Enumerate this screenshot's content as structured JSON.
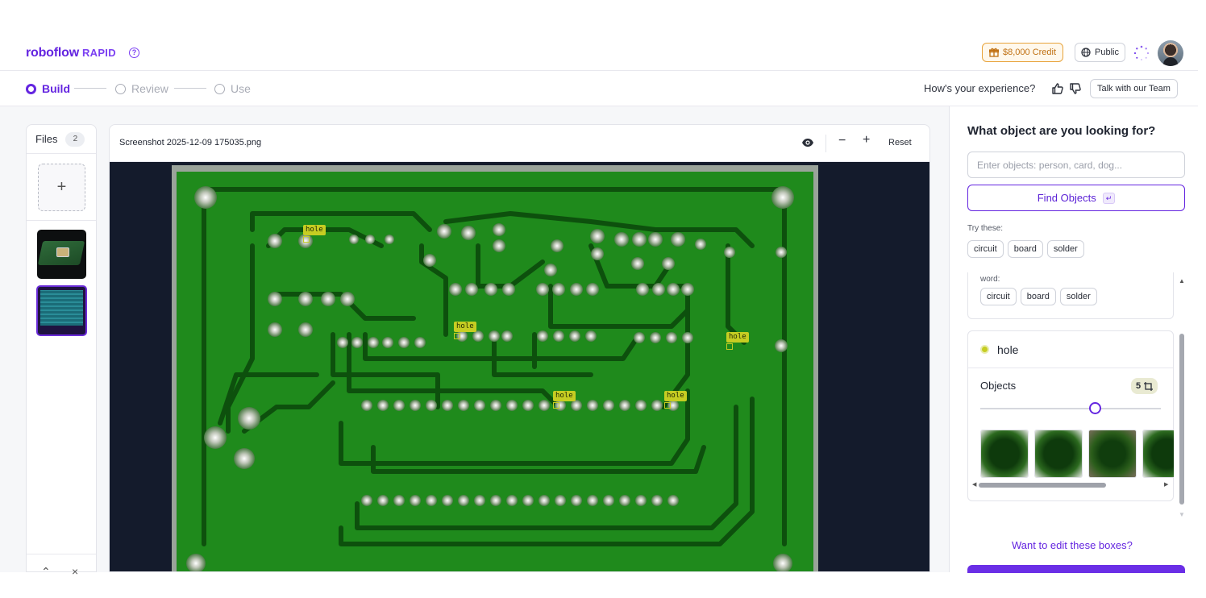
{
  "header": {
    "brand": "roboflow",
    "brand_suffix": "RAPID",
    "help_glyph": "?",
    "credit_label": "$8,000 Credit",
    "visibility_label": "Public"
  },
  "steps": [
    {
      "label": "Build",
      "state": "active"
    },
    {
      "label": "Review",
      "state": "inactive"
    },
    {
      "label": "Use",
      "state": "inactive"
    }
  ],
  "feedback": {
    "question": "How's your experience?",
    "talk_label": "Talk with our Team"
  },
  "files": {
    "label": "Files",
    "count": "2",
    "add_glyph": "+"
  },
  "viewer": {
    "file_name": "Screenshot 2025-12-09 175035.png",
    "zoom_out_glyph": "−",
    "zoom_in_glyph": "+",
    "reset_label": "Reset",
    "detections": [
      {
        "label": "hole"
      },
      {
        "label": "hole"
      },
      {
        "label": "hole"
      },
      {
        "label": "hole"
      },
      {
        "label": "hole"
      }
    ]
  },
  "panel": {
    "title": "What object are you looking for?",
    "input_placeholder": "Enter objects: person, card, dog...",
    "input_value": "",
    "find_label": "Find Objects",
    "find_key": "↵",
    "try_label": "Try these:",
    "suggestions": [
      "circuit",
      "board",
      "solder"
    ],
    "word_label": "word:",
    "word_suggestions": [
      "circuit",
      "board",
      "solder"
    ],
    "class_name": "hole",
    "class_color": "#c6cd22",
    "objects_label": "Objects",
    "objects_count": "5",
    "edit_link": "Want to edit these boxes?"
  },
  "colors": {
    "accent": "#6425e0",
    "credit": "#e8a33b",
    "detection": "#c6cd22",
    "pcb_green": "#1f8a1c"
  }
}
